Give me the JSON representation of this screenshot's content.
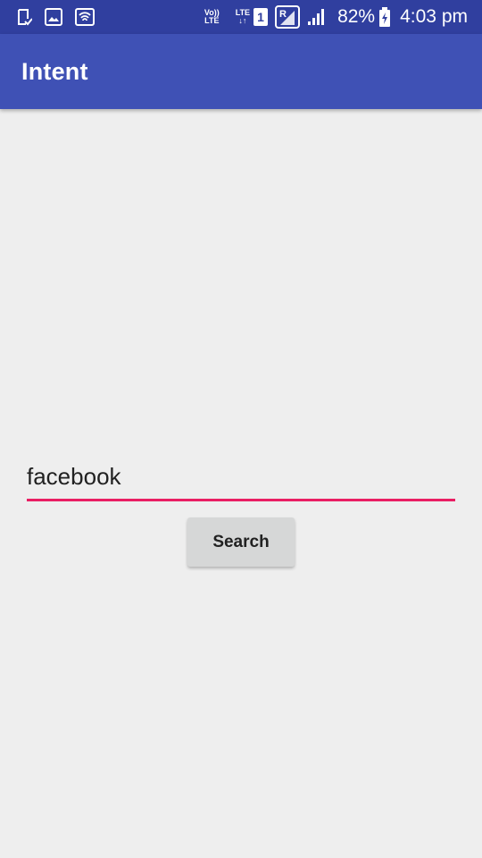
{
  "status_bar": {
    "left_icons": [
      "document-check-icon",
      "image-icon",
      "wifi-icon"
    ],
    "volte_top": "Vo))",
    "volte_bottom": "LTE",
    "lte_label": "LTE",
    "lte_arrows": "↓↑",
    "sim_number": "1",
    "roaming_label": "R",
    "battery": "82%",
    "time": "4:03 pm",
    "bar_color": "#303f9f"
  },
  "app_bar": {
    "title": "Intent",
    "color": "#3f51b5"
  },
  "form": {
    "search_value": "facebook",
    "underline_color": "#e91e63",
    "search_button_label": "Search"
  }
}
